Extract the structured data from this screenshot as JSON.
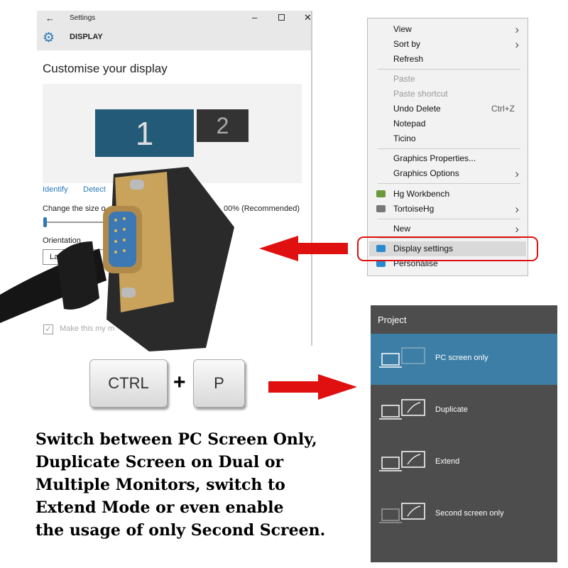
{
  "settings": {
    "title": "Settings",
    "section": "DISPLAY",
    "heading": "Customise your display",
    "monitor1": "1",
    "monitor2": "2",
    "identify": "Identify",
    "detect": "Detect",
    "size_label": "Change the size o",
    "size_value": "00% (Recommended)",
    "orientation_label": "Orientation",
    "orientation_value": "Lan",
    "checkbox_label": "Make this my m",
    "scale_slider": 0
  },
  "context_menu": {
    "items": [
      {
        "label": "View",
        "submenu": true
      },
      {
        "label": "Sort by",
        "submenu": true
      },
      {
        "label": "Refresh"
      },
      {
        "label": "Paste",
        "disabled": true
      },
      {
        "label": "Paste shortcut",
        "disabled": true
      },
      {
        "label": "Undo Delete",
        "shortcut": "Ctrl+Z"
      },
      {
        "label": "Notepad"
      },
      {
        "label": "Ticino"
      },
      {
        "label": "Graphics Properties..."
      },
      {
        "label": "Graphics Options",
        "submenu": true
      },
      {
        "label": "Hg Workbench"
      },
      {
        "label": "TortoiseHg",
        "submenu": true
      },
      {
        "label": "New",
        "submenu": true
      },
      {
        "label": "Display settings",
        "highlighted": true
      },
      {
        "label": "Personalise"
      }
    ]
  },
  "project": {
    "title": "Project",
    "items": [
      {
        "label": "PC screen only",
        "selected": true
      },
      {
        "label": "Duplicate"
      },
      {
        "label": "Extend"
      },
      {
        "label": "Second screen only"
      }
    ]
  },
  "keys": {
    "ctrl": "CTRL",
    "plus": "+",
    "p": "P"
  },
  "caption": [
    "Switch between PC Screen Only,",
    "Duplicate Screen on Dual or",
    "Multiple Monitors, switch to",
    "Extend Mode or even enable",
    "the usage of only Second Screen."
  ],
  "colors": {
    "accent": "#235a78",
    "highlight_red": "#e01010",
    "project_selected": "#3d7ea6",
    "link": "#2a7ab8"
  }
}
